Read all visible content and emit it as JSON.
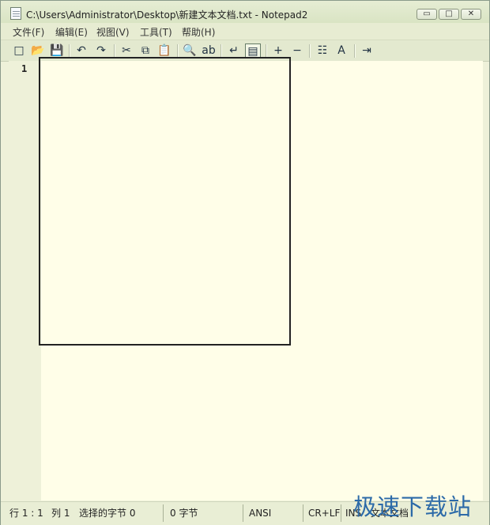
{
  "window": {
    "title": "C:\\Users\\Administrator\\Desktop\\新建文本文档.txt - Notepad2",
    "controls": {
      "minimize": "▭",
      "maximize": "□",
      "close": "✕"
    }
  },
  "menu": [
    {
      "label": "文件(F)"
    },
    {
      "label": "编辑(E)"
    },
    {
      "label": "视图(V)"
    },
    {
      "label": "工具(T)"
    },
    {
      "label": "帮助(H)"
    }
  ],
  "toolbar": {
    "buttons": [
      {
        "name": "new-icon",
        "glyph": "□"
      },
      {
        "name": "open-icon",
        "glyph": "📂"
      },
      {
        "name": "save-icon",
        "glyph": "💾"
      },
      {
        "name": "undo-icon",
        "glyph": "↶"
      },
      {
        "name": "redo-icon",
        "glyph": "↷"
      },
      {
        "name": "cut-icon",
        "glyph": "✂"
      },
      {
        "name": "copy-icon",
        "glyph": "⧉"
      },
      {
        "name": "paste-icon",
        "glyph": "📋"
      },
      {
        "name": "find-icon",
        "glyph": "🔍"
      },
      {
        "name": "replace-icon",
        "glyph": "ab"
      },
      {
        "name": "wordwrap-icon",
        "glyph": "↵"
      },
      {
        "name": "scheme-icon",
        "glyph": "▤"
      },
      {
        "name": "zoom-in-icon",
        "glyph": "+"
      },
      {
        "name": "zoom-out-icon",
        "glyph": "−"
      },
      {
        "name": "settings-icon",
        "glyph": "☷"
      },
      {
        "name": "font-icon",
        "glyph": "A"
      },
      {
        "name": "exit-icon",
        "glyph": "⇥"
      }
    ]
  },
  "editor": {
    "line_number": "1"
  },
  "status": {
    "position": "行 1 : 1",
    "column": "列 1",
    "selected": "选择的字节 0",
    "bytes": "0 字节",
    "encoding": "ANSI",
    "line_ending": "CR+LF",
    "mode": "INS",
    "doc_type": "文本文档"
  },
  "watermark": "极速下载站"
}
